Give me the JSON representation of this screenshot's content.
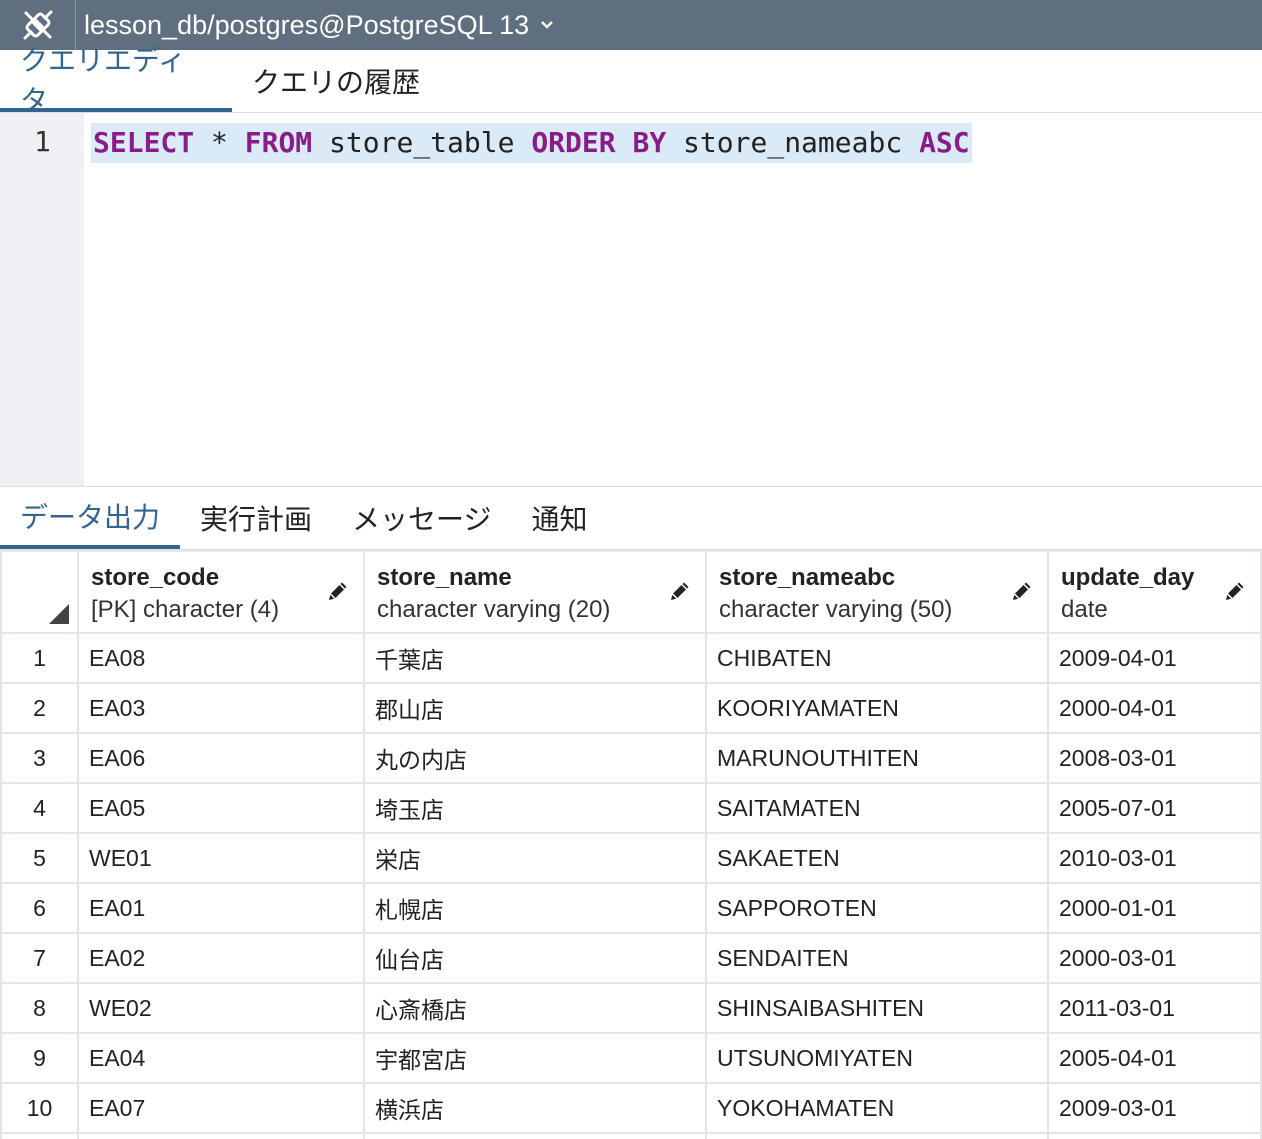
{
  "connection": {
    "label": "lesson_db/postgres@PostgreSQL 13",
    "icon": "plug-icon"
  },
  "editor_tabs": [
    {
      "label": "クエリエディタ",
      "active": true
    },
    {
      "label": "クエリの履歴",
      "active": false
    }
  ],
  "editor": {
    "line_number": "1",
    "tokens": {
      "select": "SELECT",
      "star": "*",
      "from": "FROM",
      "table": "store_table",
      "order_by": "ORDER BY",
      "column": "store_nameabc",
      "asc": "ASC"
    }
  },
  "result_tabs": [
    {
      "label": "データ出力",
      "active": true
    },
    {
      "label": "実行計画",
      "active": false
    },
    {
      "label": "メッセージ",
      "active": false
    },
    {
      "label": "通知",
      "active": false
    }
  ],
  "grid": {
    "columns": [
      {
        "name": "store_code",
        "type": "[PK] character (4)"
      },
      {
        "name": "store_name",
        "type": "character varying (20)"
      },
      {
        "name": "store_nameabc",
        "type": "character varying (50)"
      },
      {
        "name": "update_day",
        "type": "date"
      }
    ],
    "rows": [
      {
        "n": "1",
        "cells": [
          "EA08",
          "千葉店",
          "CHIBATEN",
          "2009-04-01"
        ]
      },
      {
        "n": "2",
        "cells": [
          "EA03",
          "郡山店",
          "KOORIYAMATEN",
          "2000-04-01"
        ]
      },
      {
        "n": "3",
        "cells": [
          "EA06",
          "丸の内店",
          "MARUNOUTHITEN",
          "2008-03-01"
        ]
      },
      {
        "n": "4",
        "cells": [
          "EA05",
          "埼玉店",
          "SAITAMATEN",
          "2005-07-01"
        ]
      },
      {
        "n": "5",
        "cells": [
          "WE01",
          "栄店",
          "SAKAETEN",
          "2010-03-01"
        ]
      },
      {
        "n": "6",
        "cells": [
          "EA01",
          "札幌店",
          "SAPPOROTEN",
          "2000-01-01"
        ]
      },
      {
        "n": "7",
        "cells": [
          "EA02",
          "仙台店",
          "SENDAITEN",
          "2000-03-01"
        ]
      },
      {
        "n": "8",
        "cells": [
          "WE02",
          "心斎橋店",
          "SHINSAIBASHITEN",
          "2011-03-01"
        ]
      },
      {
        "n": "9",
        "cells": [
          "EA04",
          "宇都宮店",
          "UTSUNOMIYATEN",
          "2005-04-01"
        ]
      },
      {
        "n": "10",
        "cells": [
          "EA07",
          "横浜店",
          "YOKOHAMATEN",
          "2009-03-01"
        ]
      }
    ]
  },
  "colors": {
    "topbar": "#5f6f80",
    "accent": "#326690",
    "keyword": "#8a1c8a",
    "line_highlight": "#dbeaf7"
  }
}
